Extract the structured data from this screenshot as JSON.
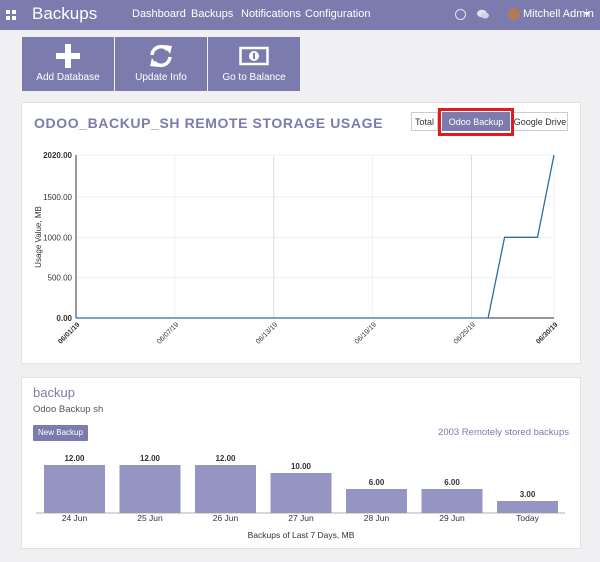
{
  "topbar": {
    "brand": "Backups",
    "nav": [
      {
        "label": "Dashboard"
      },
      {
        "label": "Backups"
      },
      {
        "label": "Notifications"
      },
      {
        "label": "Configuration"
      }
    ],
    "user": "Mitchell Admin",
    "icons": [
      "apps-icon",
      "clock-icon",
      "chat-icon",
      "user-avatar",
      "caret-down-icon"
    ]
  },
  "actions": [
    {
      "label": "Add Database",
      "icon": "plus-icon"
    },
    {
      "label": "Update Info",
      "icon": "refresh-icon"
    },
    {
      "label": "Go to Balance",
      "icon": "money-icon"
    }
  ],
  "storage": {
    "title": "ODOO_BACKUP_SH REMOTE STORAGE USAGE",
    "tabs": [
      {
        "label": "Total",
        "active": false
      },
      {
        "label": "Odoo Backup sh",
        "active": true
      },
      {
        "label": "Google Drive",
        "active": false
      }
    ]
  },
  "backup": {
    "title": "backup",
    "subtitle": "Odoo Backup sh",
    "new_button": "New Backup",
    "stored_label": "2003 Remotely stored backups"
  },
  "colors": {
    "accent": "#7c7bad",
    "highlight": "#e01b1b",
    "line": "#2b6ea7",
    "bar": "#9694c2"
  },
  "chart_data": [
    {
      "type": "line",
      "ylabel": "Usage Value, MB",
      "ylim": [
        0,
        2020
      ],
      "yticks": [
        "2020.00",
        "1500.00",
        "1000.00",
        "500.00",
        "0.00"
      ],
      "xticks": [
        "06/01/19",
        "06/07/19",
        "06/13/19",
        "06/19/19",
        "06/25/19",
        "06/30/19"
      ],
      "xlim": [
        "2019-06-01",
        "2019-06-30"
      ],
      "grid": true,
      "series": [
        {
          "x": [
            "2019-06-01",
            "2019-06-26",
            "2019-06-27",
            "2019-06-29",
            "2019-06-30"
          ],
          "values": [
            0,
            0,
            1000,
            1000,
            2020
          ]
        }
      ]
    },
    {
      "type": "bar",
      "xlabel": "Backups of Last 7 Days, MB",
      "categories": [
        "24 Jun",
        "25 Jun",
        "26 Jun",
        "27 Jun",
        "28 Jun",
        "29 Jun",
        "Today"
      ],
      "values": [
        12,
        12,
        12,
        10,
        6,
        6,
        3
      ],
      "labels": [
        "12.00",
        "12.00",
        "12.00",
        "10.00",
        "6.00",
        "6.00",
        "3.00"
      ],
      "ylim": [
        0,
        12
      ]
    }
  ]
}
